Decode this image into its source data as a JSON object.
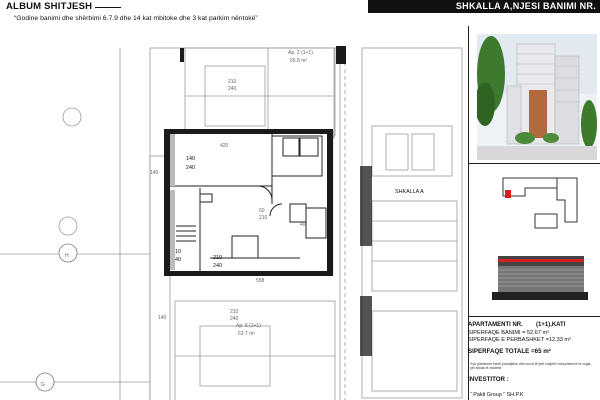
{
  "header": {
    "album_label": "ALBUM SHITJESH",
    "title": "SHKALLA A,NJESI BANIMI NR.",
    "subtitle": "“Godine banimi dhe shërbimi 6.7.9 dhe 14 kat mbitoke dhe 3 kat parkim nëntokë”"
  },
  "plan": {
    "stair_label": "SHKALLA A",
    "axis_h": "H",
    "axis_g": "G",
    "room_dims": {
      "upper_w": "140",
      "upper_h": "240",
      "lower_w": "210",
      "lower_h": "240",
      "lower_small_w": "10",
      "lower_small_h": "40",
      "top_dim": "420",
      "bottom_dim": "558",
      "mid_left_a": "60",
      "mid_left_b": "210",
      "mid_right": "40",
      "side_dim": "140"
    },
    "neighbors": {
      "top_label": "Ap. 2 (1+1)",
      "top_area": "65.8 m²",
      "top_dim": "210",
      "top_dim2": "240",
      "bottom_label": "Ap. 6 (1+1)",
      "bottom_area": "63.7 m²",
      "bottom_dim": "210",
      "bottom_dim2": "240",
      "bottom_side": "140"
    }
  },
  "info": {
    "apartment_label": "APARTAMENTI NR.",
    "apartment_type": "(1+1),KATI",
    "surface_living": "SIPERFAQE BANIMI = 52.67 m²",
    "surface_shared": "SIPERFAQE E PERBASHKET =12.33 m²",
    "surface_total": "SIPERFAQE TOTALE =65 m²",
    "note": "*Kjo planimetri është paraqitëse dhe mund të jetë subjekt i ndryshimeve të vogla për shkak të zbatimit",
    "investor_label": "INVESTITOR :",
    "investor_value": "“ Pakti Group ” SH.P.K"
  },
  "colors": {
    "highlight_red": "#d81e1e",
    "building_facade": "#e9e9ee",
    "wood_core": "#b06a3e",
    "sky": "#eef2f6",
    "tree_green": "#3d7a2e"
  }
}
